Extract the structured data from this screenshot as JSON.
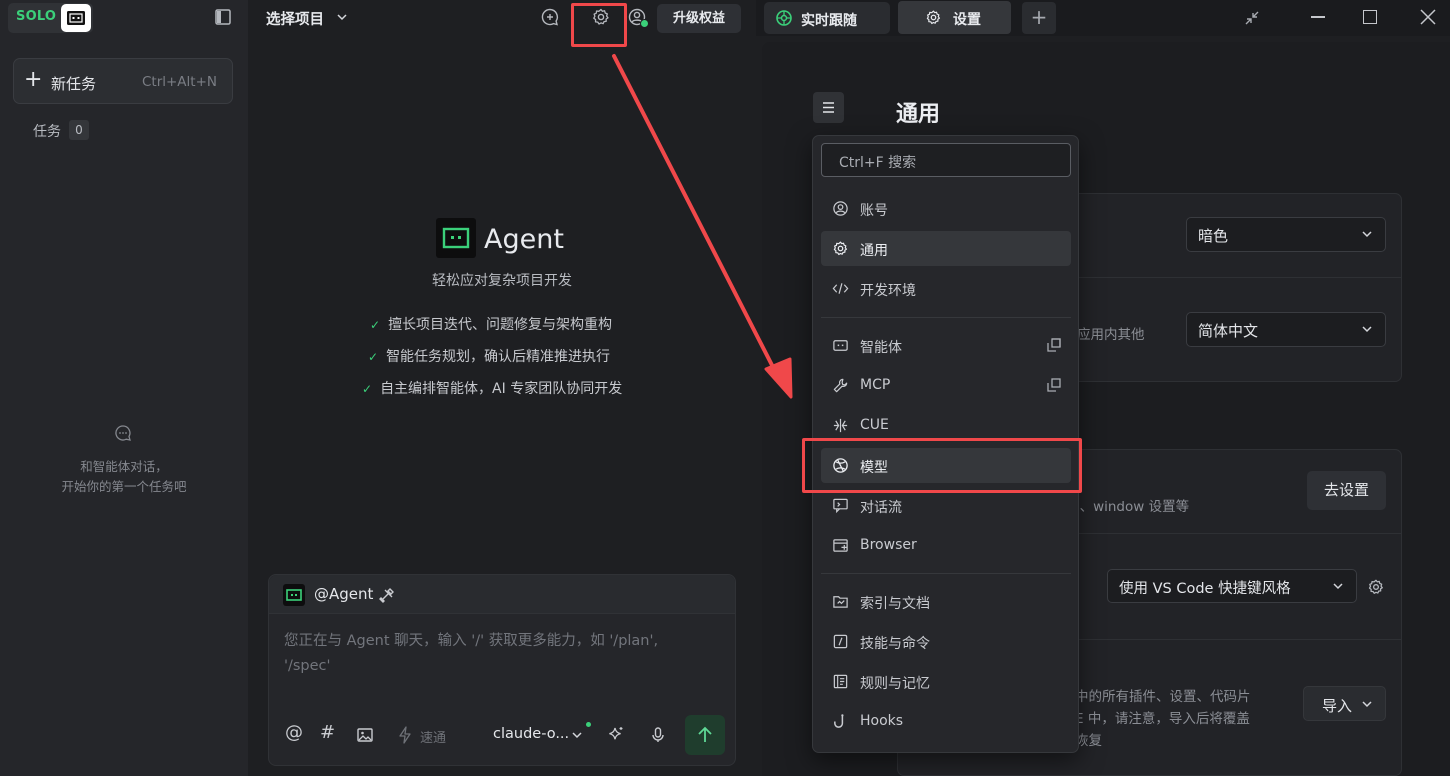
{
  "sidebar": {
    "logo_text": "SOLO",
    "new_task_label": "新任务",
    "new_task_shortcut": "Ctrl+Alt+N",
    "tasks_label": "任务",
    "tasks_count": "0",
    "empty_line1": "和智能体对话，",
    "empty_line2": "开始你的第一个任务吧"
  },
  "chat": {
    "project_selector": "选择项目",
    "upgrade_label": "升级权益",
    "agent_title": "Agent",
    "agent_subtitle": "轻松应对复杂项目开发",
    "features": [
      "擅长项目迭代、问题修复与架构重构",
      "智能任务规划，确认后精准推进执行",
      "自主编排智能体，AI 专家团队协同开发"
    ],
    "composer": {
      "agent_mention": "@Agent",
      "placeholder_line1": "您正在与 Agent 聊天，输入 '/' 获取更多能力，如 '/plan',",
      "placeholder_line2": "'/spec'",
      "at_symbol": "@",
      "hash_symbol": "#",
      "speed_label": "速通",
      "model_label": "claude-o..."
    }
  },
  "tabs": {
    "live_label": "实时跟随",
    "settings_label": "设置",
    "add_label": "+"
  },
  "settings": {
    "title": "通用",
    "theme_value": "暗色",
    "language_value": "简体中文",
    "language_desc": "应用内其他",
    "goto_button": "去设置",
    "window_desc": "p、window 设置等",
    "keymap_value": "使用 VS Code 快捷键风格",
    "import_desc_line1": "中的所有插件、设置、代码片",
    "import_desc_line2": "E 中，请注意，导入后将覆盖",
    "import_desc_line3": "恢复",
    "import_button": "导入"
  },
  "dropdown": {
    "search_placeholder": "Ctrl+F 搜索",
    "items": [
      {
        "label": "账号",
        "icon": "account-icon"
      },
      {
        "label": "通用",
        "icon": "gear-icon",
        "active": true
      },
      {
        "label": "开发环境",
        "icon": "code-icon"
      },
      {
        "label": "智能体",
        "icon": "agent-icon"
      },
      {
        "label": "MCP",
        "icon": "wrench-icon"
      },
      {
        "label": "CUE",
        "icon": "cue-icon"
      },
      {
        "label": "模型",
        "icon": "model-icon"
      },
      {
        "label": "对话流",
        "icon": "chat-flow-icon"
      },
      {
        "label": "Browser",
        "icon": "browser-icon"
      },
      {
        "label": "索引与文档",
        "icon": "index-icon"
      },
      {
        "label": "技能与命令",
        "icon": "skills-icon"
      },
      {
        "label": "规则与记忆",
        "icon": "rules-icon"
      },
      {
        "label": "Hooks",
        "icon": "hooks-icon"
      }
    ]
  },
  "colors": {
    "accent_green": "#3bd07a",
    "highlight_red": "#f0484a",
    "background": "#1e1f22"
  }
}
